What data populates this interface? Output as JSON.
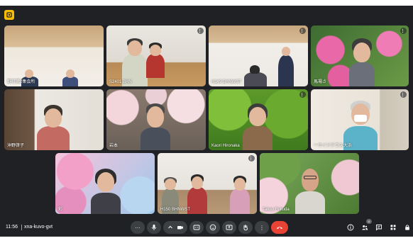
{
  "meeting": {
    "time": "11:56",
    "code": "xna-kuvo-gvt",
    "participant_count": "11"
  },
  "colors": {
    "background": "#202124",
    "tile": "#3c4043",
    "end_call": "#ea4335",
    "app_badge": "#fbbc04"
  },
  "tiles": [
    {
      "name": "野町第2集会所",
      "icon": "more-options-icon"
    },
    {
      "name": "S2401 BHN",
      "icon": "more-options-icon"
    },
    {
      "name": "H149 BHNWST",
      "icon": "more-options-icon"
    },
    {
      "name": "馬場さ",
      "icon": "more-options-icon"
    },
    {
      "name": "沖野啓子",
      "icon": "more-options-icon"
    },
    {
      "name": "岩本",
      "icon": "more-options-icon"
    },
    {
      "name": "Kaori Hironaka",
      "icon": "more-options-icon"
    },
    {
      "name": "ーサイドテラス大浜",
      "icon": "more-options-icon"
    },
    {
      "name": "彩",
      "icon": "more-options-icon"
    },
    {
      "name": "H150 BHNWST",
      "icon": "more-options-icon"
    },
    {
      "name": "Takuo Fukuda",
      "icon": "more-options-icon"
    }
  ],
  "controls": [
    {
      "name": "more-actions-icon",
      "glyph": "···"
    },
    {
      "name": "microphone-icon",
      "glyph": ""
    },
    {
      "name": "camera-icon",
      "glyph": ""
    },
    {
      "name": "captions-icon",
      "glyph": ""
    },
    {
      "name": "emoji-icon",
      "glyph": ""
    },
    {
      "name": "present-icon",
      "glyph": ""
    },
    {
      "name": "raise-hand-icon",
      "glyph": ""
    },
    {
      "name": "overflow-menu-icon",
      "glyph": "⋮"
    },
    {
      "name": "end-call-icon",
      "glyph": ""
    }
  ],
  "right_controls": [
    "info-icon",
    "people-icon",
    "chat-icon",
    "activities-icon",
    "host-controls-icon"
  ]
}
